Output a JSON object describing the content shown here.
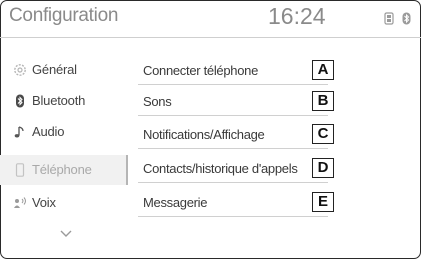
{
  "header": {
    "title": "Configuration",
    "clock": "16:24"
  },
  "status_icons": [
    "phone-battery-icon",
    "bluetooth-icon"
  ],
  "sidebar": {
    "items": [
      {
        "label": "Général",
        "icon": "gear-icon",
        "selected": false
      },
      {
        "label": "Bluetooth",
        "icon": "bluetooth-icon",
        "selected": false
      },
      {
        "label": "Audio",
        "icon": "music-note-icon",
        "selected": false
      },
      {
        "label": "Téléphone",
        "icon": "phone-icon",
        "selected": true
      },
      {
        "label": "Voix",
        "icon": "voice-icon",
        "selected": false
      }
    ],
    "more_icon": "chevron-down-icon"
  },
  "menu": {
    "items": [
      {
        "label": "Connecter téléphone",
        "callout": "A"
      },
      {
        "label": "Sons",
        "callout": "B"
      },
      {
        "label": "Notifications/Affichage",
        "callout": "C"
      },
      {
        "label": "Contacts/historique d'appels",
        "callout": "D"
      },
      {
        "label": "Messagerie",
        "callout": "E"
      }
    ]
  },
  "colors": {
    "text_primary": "#3a3a3a",
    "text_muted": "#8a8a8a",
    "selected_bg": "#f1f1f1",
    "divider": "#d0d0d0"
  }
}
